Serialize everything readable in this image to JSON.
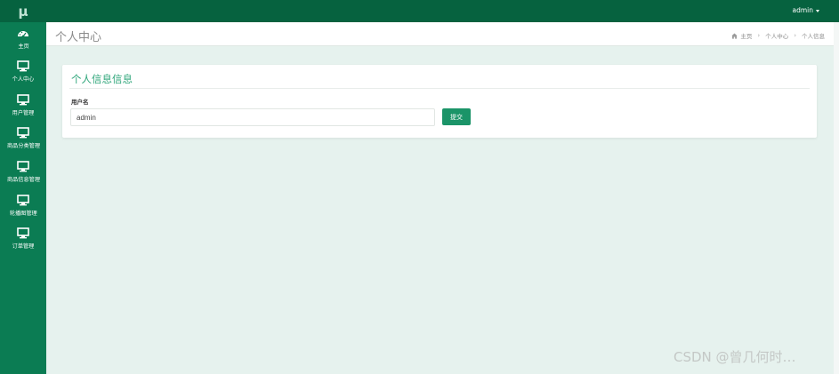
{
  "logo": {
    "text": "μ"
  },
  "sidebar": {
    "items": [
      {
        "label": "主页",
        "icon": "dashboard-icon"
      },
      {
        "label": "个人中心",
        "icon": "monitor-icon"
      },
      {
        "label": "用户管理",
        "icon": "monitor-icon"
      },
      {
        "label": "商品分类管理",
        "icon": "monitor-icon"
      },
      {
        "label": "商品信息管理",
        "icon": "monitor-icon"
      },
      {
        "label": "轮播图管理",
        "icon": "monitor-icon"
      },
      {
        "label": "订单管理",
        "icon": "monitor-icon"
      }
    ]
  },
  "topbar": {
    "user": "admin"
  },
  "header": {
    "title": "个人中心",
    "breadcrumb": [
      "主页",
      "个人中心",
      "个人信息"
    ]
  },
  "form": {
    "title": "个人信息信息",
    "username_label": "用户名",
    "username_value": "admin",
    "submit_label": "提交"
  },
  "watermark": "CSDN @曾几何时…",
  "colors": {
    "sidebar": "#0b7c53",
    "topbar": "#06623f",
    "accent": "#2fa67a",
    "button": "#1b9468",
    "background": "#e6f2ee"
  }
}
